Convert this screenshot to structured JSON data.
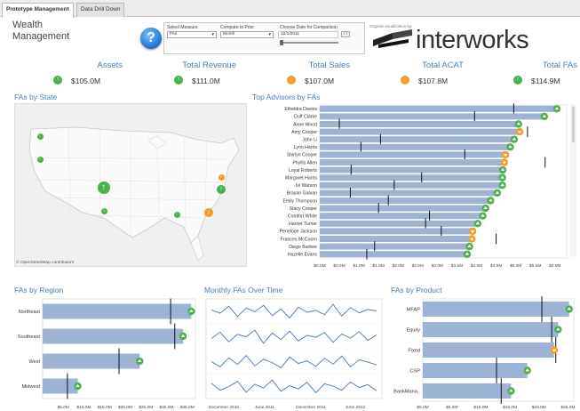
{
  "tabs": [
    {
      "label": "Prototype Management",
      "active": true
    },
    {
      "label": "Data Drill Down",
      "active": false
    }
  ],
  "header": {
    "title": "Wealth Management",
    "help_icon": "question-mark-icon",
    "controls": {
      "select_measure_label": "Select Measure",
      "select_measure_value": "FAs",
      "compare_label": "Compare to Prior",
      "compare_value": "Month",
      "date_label": "Choose Date for Comparison",
      "date_value": "10/1/2011"
    },
    "original_by": "Original visualization by:",
    "logo_text": "interworks"
  },
  "kpis": [
    {
      "label": "Assets",
      "value": "$105.0M",
      "trend": "up"
    },
    {
      "label": "Total Revenue",
      "value": "$111.0M",
      "trend": "up"
    },
    {
      "label": "Total Sales",
      "value": "$107.0M",
      "trend": "down"
    },
    {
      "label": "Total ACAT",
      "value": "$107.8M",
      "trend": "down"
    },
    {
      "label": "Total FAs",
      "value": "$114.9M",
      "trend": "up"
    }
  ],
  "sections": {
    "fas_by_state": "FAs by State",
    "top_advisors": "Top Advisors by FAs",
    "fas_by_region": "FAs by Region",
    "monthly_fas": "Monthly FAs Over Time",
    "fas_by_product": "FAs by Product",
    "map_credit": "© OpenStreetMap contributors"
  },
  "colors": {
    "bar": "#9db3d4",
    "accent_blue": "#4a7fb5",
    "up": "#4caf50",
    "down": "#f39c26",
    "line": "#4a79b0"
  },
  "map_markers": [
    {
      "trend": "up",
      "size": "small"
    },
    {
      "trend": "up",
      "size": "small"
    },
    {
      "trend": "up",
      "size": "large"
    },
    {
      "trend": "up",
      "size": "small"
    },
    {
      "trend": "down",
      "size": "small"
    },
    {
      "trend": "up",
      "size": "medium"
    },
    {
      "trend": "down",
      "size": "medium"
    },
    {
      "trend": "up",
      "size": "small"
    }
  ],
  "chart_data": [
    {
      "type": "bar",
      "title": "Top Advisors by FAs",
      "categories": [
        "Etheldra Davies",
        "Duff Clarke",
        "Anne Wood",
        "Amy Cooper",
        "John Li",
        "Lynn Harris",
        "Shirlyn Cooper",
        "Phyllis Allen",
        "Loyal Roberts",
        "Margaret Harris",
        "Ivi Watson",
        "Brayan Galvan",
        "Emily Thompson",
        "Stacy Cooper",
        "Comfort White",
        "Harriet Turner",
        "Penelope Jackson",
        "Frances McCoorn",
        "Diego Barbee",
        "Hazelle Evans"
      ],
      "values": [
        6.05,
        5.73,
        5.07,
        5.1,
        4.96,
        4.86,
        4.74,
        4.71,
        4.67,
        4.66,
        4.66,
        4.53,
        4.36,
        4.23,
        4.16,
        4.03,
        3.9,
        3.88,
        3.82,
        3.76
      ],
      "trends": [
        "up",
        "up",
        "up",
        "down",
        "up",
        "up",
        "down",
        "down",
        "up",
        "up",
        "up",
        "up",
        "up",
        "up",
        "up",
        "up",
        "down",
        "down",
        "up",
        "up"
      ],
      "targets": [
        4.95,
        3.95,
        0.5,
        5.3,
        1.55,
        1.05,
        3.7,
        5.75,
        0.8,
        2.6,
        1.9,
        0.78,
        1.75,
        1.5,
        2.8,
        2.7,
        3.1,
        4.5,
        1.4,
        1.2
      ],
      "xticks": [
        "$0.0M",
        "$0.5M",
        "$1.0M",
        "$1.5M",
        "$2.0M",
        "$2.5M",
        "$3.0M",
        "$3.5M",
        "$4.0M",
        "$4.5M",
        "$5.0M",
        "$5.5M",
        "$6.0M"
      ],
      "xlim": [
        0,
        6.3
      ]
    },
    {
      "type": "bar",
      "title": "FAs by Region",
      "categories": [
        "Northeast",
        "Southeast",
        "West",
        "Midwest"
      ],
      "values": [
        36.0,
        34.0,
        23.5,
        8.5
      ],
      "trends": [
        "up",
        "up",
        "up",
        "up"
      ],
      "targets": [
        31.0,
        32.0,
        18.5,
        6.0
      ],
      "xticks": [
        "$5.0M",
        "$10.0M",
        "$15.0M",
        "$20.0M",
        "$25.0M",
        "$30.0M",
        "$35.0M"
      ],
      "xlim": [
        0,
        37
      ]
    },
    {
      "type": "line",
      "title": "Monthly FAs Over Time",
      "xticks": [
        "December 2010",
        "June 2011",
        "December 2011",
        "June 2012"
      ],
      "series": [
        {
          "values": [
            62,
            55,
            70,
            48,
            66,
            58,
            72,
            50,
            64,
            45,
            68,
            57,
            61,
            52,
            74,
            49,
            67,
            56,
            63,
            60
          ]
        },
        {
          "values": [
            54,
            68,
            47,
            63,
            58,
            72,
            44,
            66,
            52,
            70,
            49,
            61,
            57,
            67,
            46,
            64,
            55,
            69,
            50,
            62
          ]
        },
        {
          "values": [
            58,
            47,
            66,
            52,
            71,
            49,
            63,
            56,
            45,
            68,
            54,
            60,
            48,
            65,
            53,
            70,
            47,
            62,
            57,
            51
          ]
        },
        {
          "values": [
            65,
            50,
            58,
            69,
            46,
            63,
            55,
            72,
            48,
            60,
            53,
            67,
            45,
            64,
            59,
            50,
            68,
            56,
            62,
            49
          ]
        }
      ]
    },
    {
      "type": "bar",
      "title": "FAs by Product",
      "categories": [
        "MFAP",
        "Equity",
        "Fixed",
        "CSP",
        "BankMana.."
      ],
      "values": [
        25.2,
        23.3,
        22.6,
        18.0,
        15.2
      ],
      "trends": [
        "up",
        "up",
        "down",
        "up",
        "up"
      ],
      "targets": [
        20.5,
        22.2,
        22.9,
        12.7,
        13.5
      ],
      "xticks": [
        "$0.0M",
        "$5.0M",
        "$10.0M",
        "$15.0M",
        "$20.0M",
        "$25.0M"
      ],
      "xlim": [
        0,
        26
      ]
    }
  ]
}
